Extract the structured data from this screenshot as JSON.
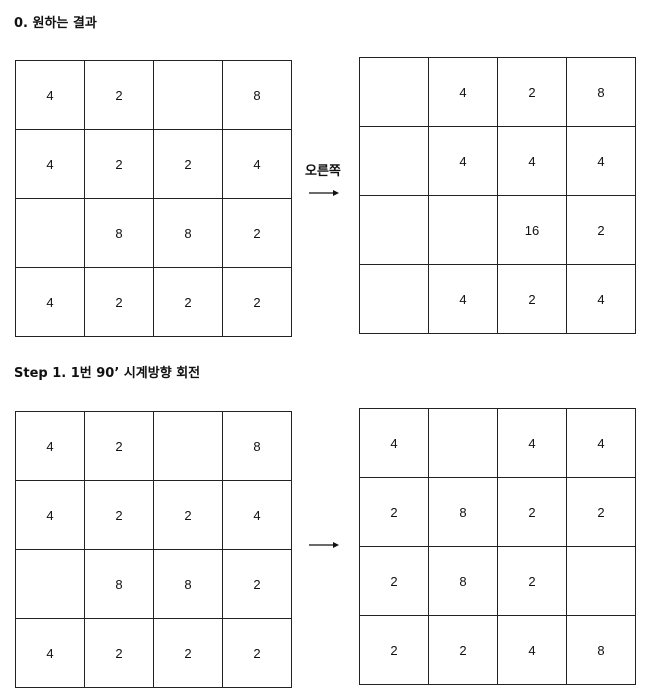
{
  "sections": [
    {
      "heading": "0. 원하는 결과",
      "operation_label": "오른쪽",
      "before": [
        [
          "4",
          "2",
          "",
          "8"
        ],
        [
          "4",
          "2",
          "2",
          "4"
        ],
        [
          "",
          "8",
          "8",
          "2"
        ],
        [
          "4",
          "2",
          "2",
          "2"
        ]
      ],
      "after": [
        [
          "",
          "4",
          "2",
          "8"
        ],
        [
          "",
          "4",
          "4",
          "4"
        ],
        [
          "",
          "",
          "16",
          "2"
        ],
        [
          "",
          "4",
          "2",
          "4"
        ]
      ]
    },
    {
      "heading": "Step 1. 1번 90’ 시계방향 회전",
      "operation_label": "",
      "before": [
        [
          "4",
          "2",
          "",
          "8"
        ],
        [
          "4",
          "2",
          "2",
          "4"
        ],
        [
          "",
          "8",
          "8",
          "2"
        ],
        [
          "4",
          "2",
          "2",
          "2"
        ]
      ],
      "after": [
        [
          "4",
          "",
          "4",
          "4"
        ],
        [
          "2",
          "8",
          "2",
          "2"
        ],
        [
          "2",
          "8",
          "2",
          ""
        ],
        [
          "2",
          "2",
          "4",
          "8"
        ]
      ]
    }
  ]
}
